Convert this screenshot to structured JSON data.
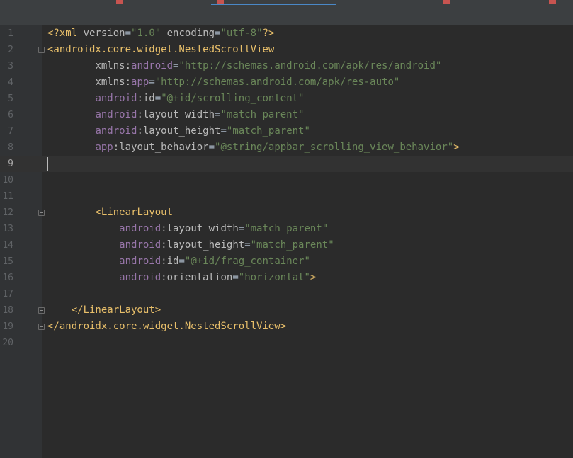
{
  "editor": {
    "lines": [
      {
        "n": "1",
        "parts": [
          [
            "t",
            "<?xml "
          ],
          [
            "ap",
            "version"
          ],
          [
            "pl",
            "="
          ],
          [
            "av",
            "\"1.0\""
          ],
          [
            "pl",
            " "
          ],
          [
            "ap",
            "encoding"
          ],
          [
            "pl",
            "="
          ],
          [
            "av",
            "\"utf-8\""
          ],
          [
            "t",
            "?>"
          ]
        ]
      },
      {
        "n": "2",
        "parts": [
          [
            "t",
            "<androidx.core.widget.NestedScrollView"
          ]
        ]
      },
      {
        "n": "3",
        "parts": [
          [
            "pl",
            "        "
          ],
          [
            "ap",
            "xmlns:"
          ],
          [
            "an",
            "android"
          ],
          [
            "pl",
            "="
          ],
          [
            "av",
            "\"http://schemas.android.com/apk/res/android\""
          ]
        ]
      },
      {
        "n": "4",
        "parts": [
          [
            "pl",
            "        "
          ],
          [
            "ap",
            "xmlns:"
          ],
          [
            "an",
            "app"
          ],
          [
            "pl",
            "="
          ],
          [
            "av",
            "\"http://schemas.android.com/apk/res-auto\""
          ]
        ]
      },
      {
        "n": "5",
        "parts": [
          [
            "pl",
            "        "
          ],
          [
            "an",
            "android"
          ],
          [
            "ap",
            ":id"
          ],
          [
            "pl",
            "="
          ],
          [
            "av",
            "\"@+id/scrolling_content\""
          ]
        ]
      },
      {
        "n": "6",
        "parts": [
          [
            "pl",
            "        "
          ],
          [
            "an",
            "android"
          ],
          [
            "ap",
            ":layout_width"
          ],
          [
            "pl",
            "="
          ],
          [
            "av",
            "\"match_parent\""
          ]
        ]
      },
      {
        "n": "7",
        "parts": [
          [
            "pl",
            "        "
          ],
          [
            "an",
            "android"
          ],
          [
            "ap",
            ":layout_height"
          ],
          [
            "pl",
            "="
          ],
          [
            "av",
            "\"match_parent\""
          ]
        ]
      },
      {
        "n": "8",
        "parts": [
          [
            "pl",
            "        "
          ],
          [
            "an",
            "app"
          ],
          [
            "ap",
            ":layout_behavior"
          ],
          [
            "pl",
            "="
          ],
          [
            "av",
            "\"@string/appbar_scrolling_view_behavior\""
          ],
          [
            "t",
            ">"
          ]
        ]
      },
      {
        "n": "9",
        "parts": []
      },
      {
        "n": "10",
        "parts": []
      },
      {
        "n": "11",
        "parts": []
      },
      {
        "n": "12",
        "parts": [
          [
            "pl",
            "        "
          ],
          [
            "t",
            "<LinearLayout"
          ]
        ]
      },
      {
        "n": "13",
        "parts": [
          [
            "pl",
            "            "
          ],
          [
            "an",
            "android"
          ],
          [
            "ap",
            ":layout_width"
          ],
          [
            "pl",
            "="
          ],
          [
            "av",
            "\"match_parent\""
          ]
        ]
      },
      {
        "n": "14",
        "parts": [
          [
            "pl",
            "            "
          ],
          [
            "an",
            "android"
          ],
          [
            "ap",
            ":layout_height"
          ],
          [
            "pl",
            "="
          ],
          [
            "av",
            "\"match_parent\""
          ]
        ]
      },
      {
        "n": "15",
        "parts": [
          [
            "pl",
            "            "
          ],
          [
            "an",
            "android"
          ],
          [
            "ap",
            ":id"
          ],
          [
            "pl",
            "="
          ],
          [
            "av",
            "\"@+id/frag_container\""
          ]
        ]
      },
      {
        "n": "16",
        "parts": [
          [
            "pl",
            "            "
          ],
          [
            "an",
            "android"
          ],
          [
            "ap",
            ":orientation"
          ],
          [
            "pl",
            "="
          ],
          [
            "av",
            "\"horizontal\""
          ],
          [
            "t",
            ">"
          ]
        ]
      },
      {
        "n": "17",
        "parts": []
      },
      {
        "n": "18",
        "parts": [
          [
            "pl",
            "    "
          ],
          [
            "t",
            "</LinearLayout>"
          ]
        ]
      },
      {
        "n": "19",
        "parts": [
          [
            "t",
            "</androidx.core.widget.NestedScrollView>"
          ]
        ]
      },
      {
        "n": "20",
        "parts": []
      }
    ],
    "current_line": "9"
  }
}
